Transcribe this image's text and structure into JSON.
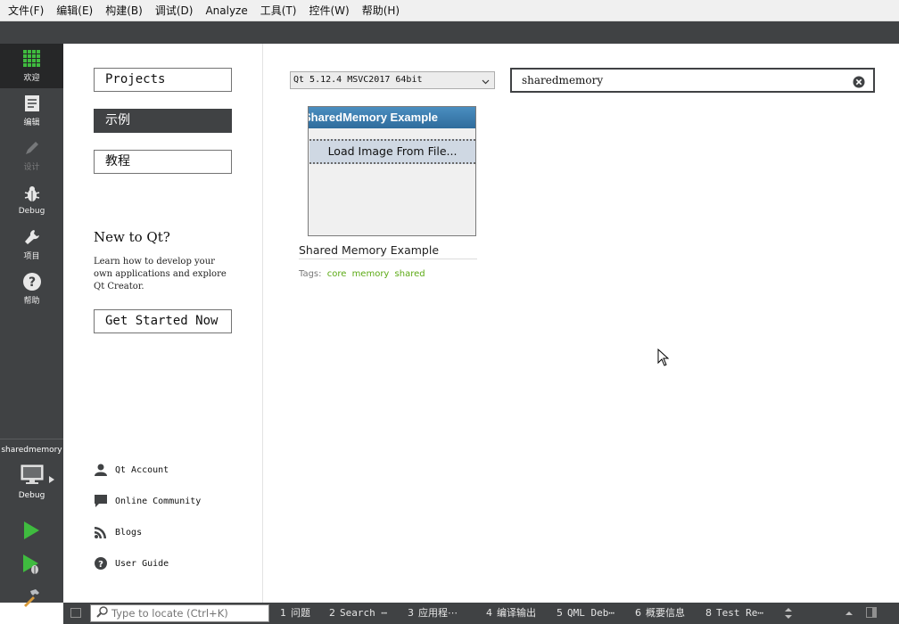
{
  "menu": [
    {
      "label": "文件(F)"
    },
    {
      "label": "编辑(E)"
    },
    {
      "label": "构建(B)"
    },
    {
      "label": "调试(D)"
    },
    {
      "label": "Analyze"
    },
    {
      "label": "工具(T)"
    },
    {
      "label": "控件(W)"
    },
    {
      "label": "帮助(H)"
    }
  ],
  "modes": [
    {
      "label": "欢迎",
      "icon": "grid-icon",
      "state": "active"
    },
    {
      "label": "编辑",
      "icon": "document-icon",
      "state": "normal"
    },
    {
      "label": "设计",
      "icon": "pencil-icon",
      "state": "disabled"
    },
    {
      "label": "Debug",
      "icon": "bug-icon",
      "state": "normal"
    },
    {
      "label": "项目",
      "icon": "wrench-icon",
      "state": "normal"
    },
    {
      "label": "帮助",
      "icon": "help-icon",
      "state": "normal"
    }
  ],
  "kit": {
    "project": "sharedmemory",
    "build": "Debug"
  },
  "welcome": {
    "buttons": [
      "Projects",
      "示例",
      "教程"
    ],
    "selected": "示例",
    "new_title": "New to Qt?",
    "new_desc": "Learn how to develop your own applications and explore Qt Creator.",
    "get_started": "Get Started Now",
    "links": [
      {
        "label": "Qt Account",
        "icon": "user-icon"
      },
      {
        "label": "Online Community",
        "icon": "chat-icon"
      },
      {
        "label": "Blogs",
        "icon": "rss-icon"
      },
      {
        "label": "User Guide",
        "icon": "help-icon"
      }
    ]
  },
  "examples": {
    "qt_version": "Qt 5.12.4 MSVC2017 64bit",
    "search_value": "sharedmemory",
    "items": [
      {
        "thumb_title": "SharedMemory Example",
        "thumb_button": "Load Image From File...",
        "name": "Shared Memory Example",
        "tags_label": "Tags:",
        "tags": [
          "core",
          "memory",
          "shared"
        ]
      }
    ]
  },
  "statusbar": {
    "locator_placeholder": "Type to locate (Ctrl+K)",
    "panes": [
      {
        "num": "1",
        "label": "问题"
      },
      {
        "num": "2",
        "label": "Search ⋯"
      },
      {
        "num": "3",
        "label": "应用程⋯"
      },
      {
        "num": "4",
        "label": "编译输出"
      },
      {
        "num": "5",
        "label": "QML Deb⋯"
      },
      {
        "num": "6",
        "label": "概要信息"
      },
      {
        "num": "8",
        "label": "Test Re⋯"
      }
    ]
  }
}
